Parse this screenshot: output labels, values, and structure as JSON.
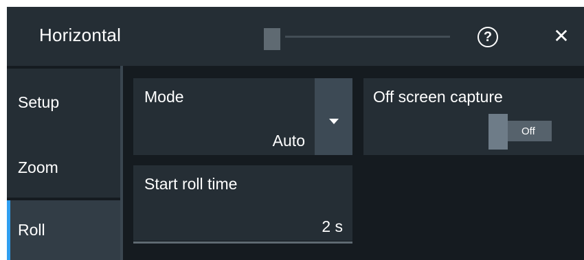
{
  "dialog": {
    "title": "Horizontal",
    "help_glyph": "?",
    "close_glyph": "✕",
    "icons": {
      "help": "help-icon",
      "close": "close-icon"
    }
  },
  "sidebar": {
    "items": [
      {
        "label": "Setup",
        "selected": false
      },
      {
        "label": "Zoom",
        "selected": false
      },
      {
        "label": "Roll",
        "selected": true
      }
    ]
  },
  "roll": {
    "mode": {
      "label": "Mode",
      "value": "Auto"
    },
    "off_screen_capture": {
      "label": "Off screen capture",
      "toggle_text": "Off",
      "enabled": false
    },
    "start_roll_time": {
      "label": "Start roll time",
      "value": "2 s"
    }
  },
  "colors": {
    "background": "#151b20",
    "panel": "#252e35",
    "accent": "#2f9ff0"
  }
}
